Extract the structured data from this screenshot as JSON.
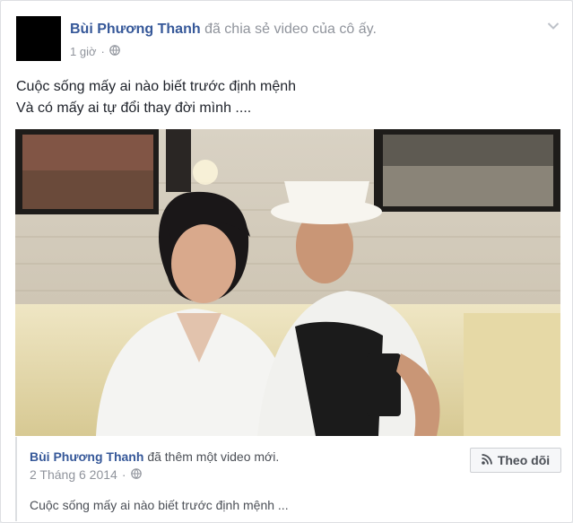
{
  "post": {
    "author": "Bùi Phương Thanh",
    "action": "đã chia sẻ video của cô ấy.",
    "time": "1 giờ",
    "separator": "·",
    "caption_lines": [
      "Cuộc sống mấy ai nào biết trước định mệnh",
      "Và có mấy ai tự đổi thay đời mình ...."
    ]
  },
  "attachment": {
    "author": "Bùi Phương Thanh",
    "action": "đã thêm một video mới.",
    "date": "2 Tháng 6 2014",
    "separator": "·",
    "follow_label": "Theo dõi",
    "description": "Cuộc sống mấy ai nào biết trước định mệnh ..."
  },
  "icons": {
    "privacy": "globe-icon",
    "menu": "chevron-down-icon",
    "follow": "rss-icon"
  },
  "colors": {
    "link": "#365899",
    "meta": "#90949c",
    "text": "#1d2129"
  }
}
